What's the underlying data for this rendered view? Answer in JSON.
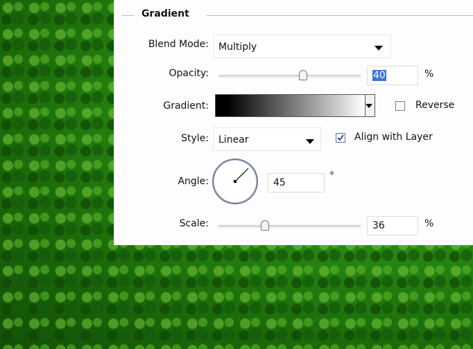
{
  "section": {
    "title": "Gradient"
  },
  "blend_mode": {
    "label": "Blend Mode:",
    "value": "Multiply"
  },
  "opacity": {
    "label": "Opacity:",
    "value": "40",
    "unit": "%",
    "slider_fraction": 0.4
  },
  "gradient": {
    "label": "Gradient:",
    "reverse_label": "Reverse",
    "reverse_checked": false
  },
  "style": {
    "label": "Style:",
    "value": "Linear",
    "align_label": "Align with Layer",
    "align_checked": true
  },
  "angle": {
    "label": "Angle:",
    "value": "45",
    "unit": "°"
  },
  "scale": {
    "label": "Scale:",
    "value": "36",
    "unit": "%",
    "slider_fraction": 0.13
  },
  "colors": {
    "panel": "#fdfdfd",
    "selection": "#3875d7",
    "check": "#2c4e9c",
    "foliage": "#2a8f12"
  }
}
